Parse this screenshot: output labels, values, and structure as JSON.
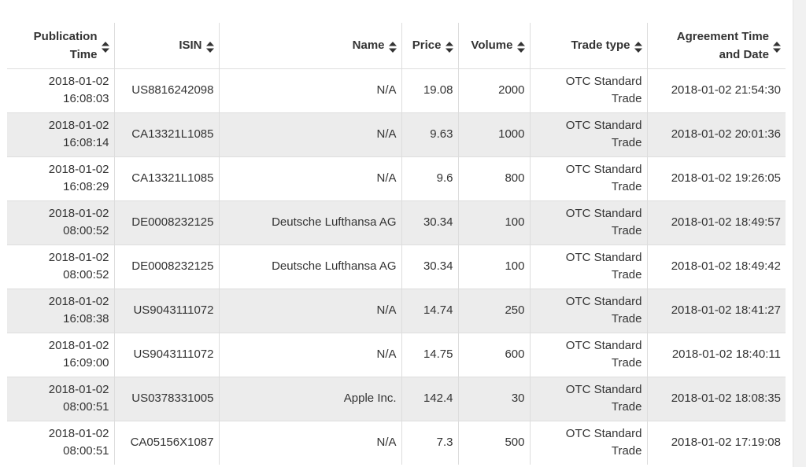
{
  "table": {
    "columns": [
      {
        "key": "pub",
        "label_line1": "Publication",
        "label_line2": "Time"
      },
      {
        "key": "isin",
        "label_line1": "ISIN",
        "label_line2": ""
      },
      {
        "key": "name",
        "label_line1": "Name",
        "label_line2": ""
      },
      {
        "key": "price",
        "label_line1": "Price",
        "label_line2": ""
      },
      {
        "key": "volume",
        "label_line1": "Volume",
        "label_line2": ""
      },
      {
        "key": "type",
        "label_line1": "Trade type",
        "label_line2": ""
      },
      {
        "key": "agree",
        "label_line1": "Agreement Time",
        "label_line2": "and Date"
      }
    ],
    "sort_icon": "sort-both-icon",
    "rows": [
      {
        "pub_date": "2018-01-02",
        "pub_time": "16:08:03",
        "isin": "US8816242098",
        "name": "N/A",
        "price": "19.08",
        "volume": "2000",
        "type_line1": "OTC Standard",
        "type_line2": "Trade",
        "agree": "2018-01-02 21:54:30"
      },
      {
        "pub_date": "2018-01-02",
        "pub_time": "16:08:14",
        "isin": "CA13321L1085",
        "name": "N/A",
        "price": "9.63",
        "volume": "1000",
        "type_line1": "OTC Standard",
        "type_line2": "Trade",
        "agree": "2018-01-02 20:01:36"
      },
      {
        "pub_date": "2018-01-02",
        "pub_time": "16:08:29",
        "isin": "CA13321L1085",
        "name": "N/A",
        "price": "9.6",
        "volume": "800",
        "type_line1": "OTC Standard",
        "type_line2": "Trade",
        "agree": "2018-01-02 19:26:05"
      },
      {
        "pub_date": "2018-01-02",
        "pub_time": "08:00:52",
        "isin": "DE0008232125",
        "name": "Deutsche Lufthansa AG",
        "price": "30.34",
        "volume": "100",
        "type_line1": "OTC Standard",
        "type_line2": "Trade",
        "agree": "2018-01-02 18:49:57"
      },
      {
        "pub_date": "2018-01-02",
        "pub_time": "08:00:52",
        "isin": "DE0008232125",
        "name": "Deutsche Lufthansa AG",
        "price": "30.34",
        "volume": "100",
        "type_line1": "OTC Standard",
        "type_line2": "Trade",
        "agree": "2018-01-02 18:49:42"
      },
      {
        "pub_date": "2018-01-02",
        "pub_time": "16:08:38",
        "isin": "US9043111072",
        "name": "N/A",
        "price": "14.74",
        "volume": "250",
        "type_line1": "OTC Standard",
        "type_line2": "Trade",
        "agree": "2018-01-02 18:41:27"
      },
      {
        "pub_date": "2018-01-02",
        "pub_time": "16:09:00",
        "isin": "US9043111072",
        "name": "N/A",
        "price": "14.75",
        "volume": "600",
        "type_line1": "OTC Standard",
        "type_line2": "Trade",
        "agree": "2018-01-02 18:40:11"
      },
      {
        "pub_date": "2018-01-02",
        "pub_time": "08:00:51",
        "isin": "US0378331005",
        "name": "Apple Inc.",
        "price": "142.4",
        "volume": "30",
        "type_line1": "OTC Standard",
        "type_line2": "Trade",
        "agree": "2018-01-02 18:08:35"
      },
      {
        "pub_date": "2018-01-02",
        "pub_time": "08:00:51",
        "isin": "CA05156X1087",
        "name": "N/A",
        "price": "7.3",
        "volume": "500",
        "type_line1": "OTC Standard",
        "type_line2": "Trade",
        "agree": "2018-01-02 17:19:08"
      }
    ]
  }
}
